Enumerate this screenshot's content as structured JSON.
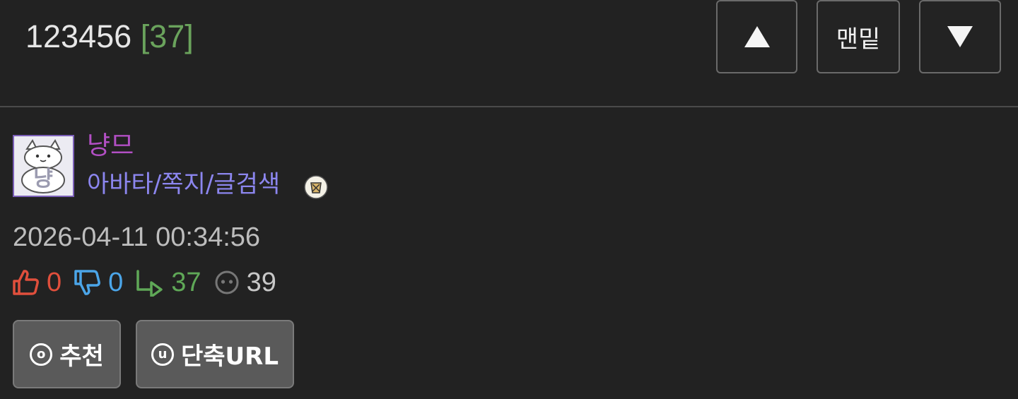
{
  "post": {
    "title": "123456",
    "comment_count_text": "[37]"
  },
  "nav": {
    "up_icon": "triangle-up-icon",
    "bottom_label": "맨밑",
    "down_icon": "triangle-down-icon"
  },
  "author": {
    "name": "냥므",
    "links_text": "아바타/쪽지/글검색",
    "avatar_text": "냥",
    "avatar_icon": "cat-avatar",
    "badge_icon": "level-badge-icon",
    "name_color": "#b24fc4",
    "links_color": "#8c86ef"
  },
  "meta": {
    "date": "2026-04-11 00:34:56"
  },
  "stats": {
    "likes": "0",
    "dislikes": "0",
    "replies": "37",
    "views": "39",
    "like_color": "#e04f3c",
    "dislike_color": "#4ba5e8",
    "reply_color": "#5fa857",
    "view_color": "#c8c8c8"
  },
  "actions": {
    "recommend_key": "o",
    "recommend_label": "추천",
    "shorturl_key": "u",
    "shorturl_label": "단축URL"
  },
  "colors": {
    "background": "#222222",
    "title_text": "#e6e6e6",
    "comment_count": "#6aa35c",
    "button_bg": "#5a5a5a"
  }
}
